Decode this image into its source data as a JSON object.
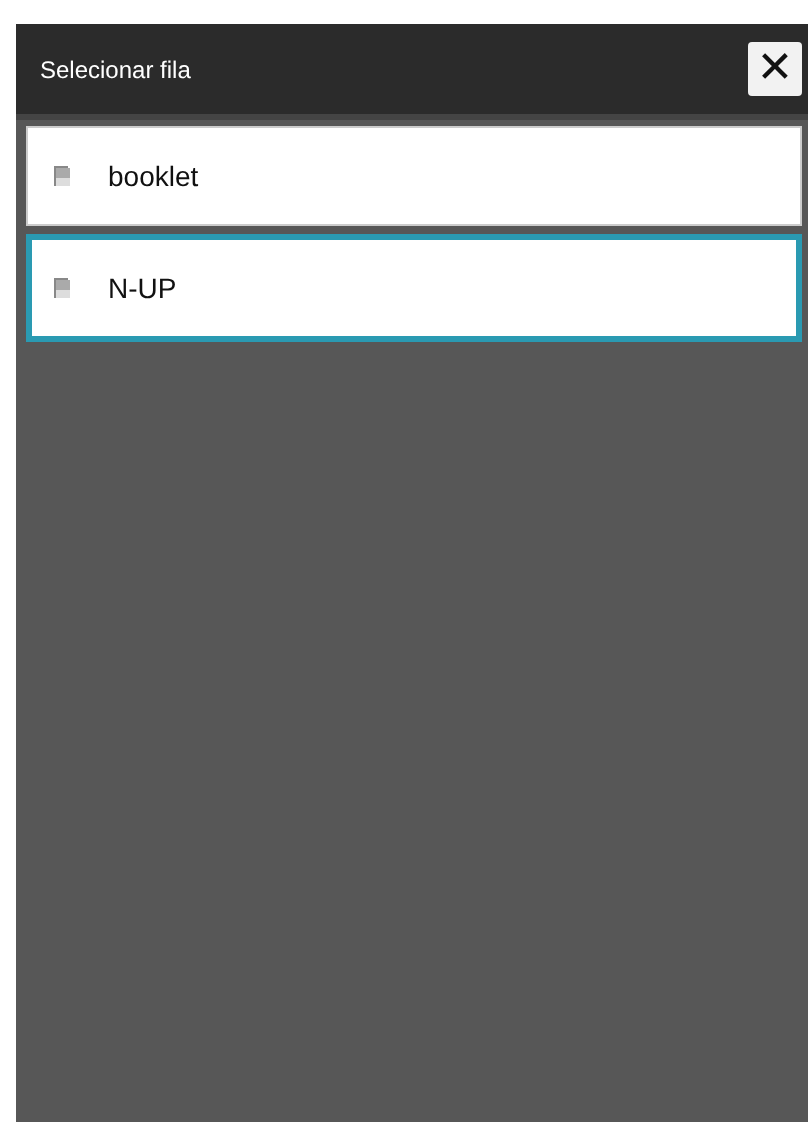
{
  "dialog": {
    "title": "Selecionar fila",
    "close": "✕"
  },
  "queues": [
    {
      "label": "booklet",
      "selected": false
    },
    {
      "label": "N-UP",
      "selected": true
    }
  ]
}
